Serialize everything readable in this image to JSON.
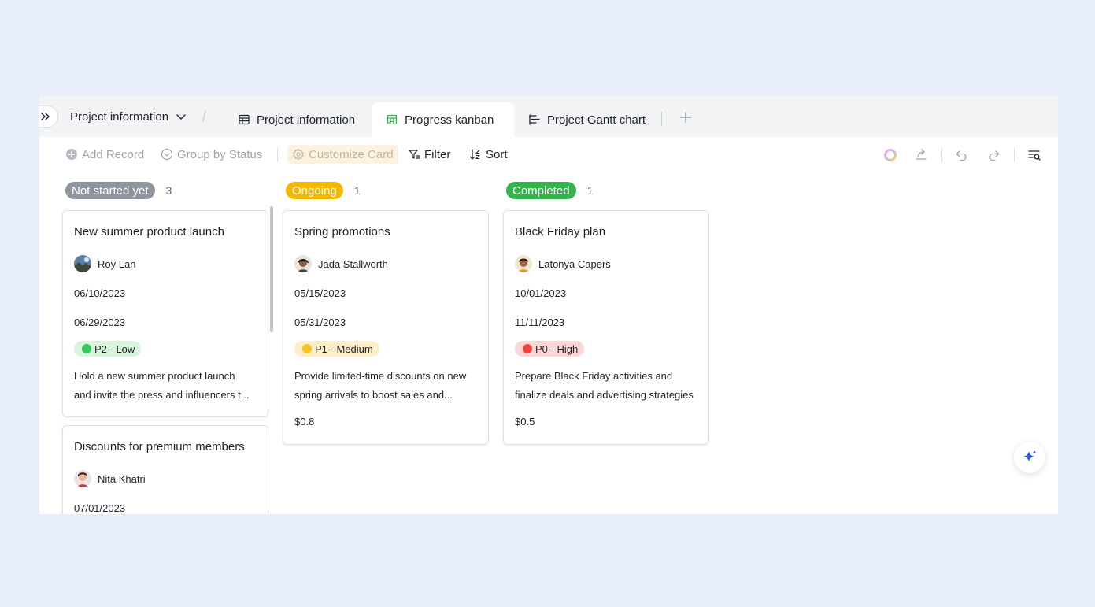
{
  "tabs": {
    "crumb_label": "Project information",
    "items": [
      {
        "label": "Project information",
        "icon": "table-icon",
        "active": false
      },
      {
        "label": "Progress kanban",
        "icon": "kanban-icon",
        "active": true
      },
      {
        "label": "Project Gantt chart",
        "icon": "gantt-icon",
        "active": false
      }
    ],
    "separator": "/"
  },
  "toolbar": {
    "add_record": "Add Record",
    "group_by": "Group by Status",
    "customize_card": "Customize Card",
    "filter": "Filter",
    "sort": "Sort"
  },
  "colors": {
    "accent_green": "#34b34a",
    "not_started": "#8f959e",
    "ongoing": "#f5b800",
    "completed": "#34b34a"
  },
  "columns": [
    {
      "status": "Not started yet",
      "count": "3",
      "color": "#8f959e",
      "cards": [
        {
          "title": "New summer product launch",
          "person": "Roy Lan",
          "start": "06/10/2023",
          "end": "06/29/2023",
          "priority": "P2 - Low",
          "priority_bg": "#d8f5dc",
          "priority_dot": "#34c759",
          "desc_line1": "Hold a new summer product launch",
          "desc_line2": "and invite the press and influencers t...",
          "budget": ""
        },
        {
          "title": "Discounts for premium members",
          "person": "Nita Khatri",
          "start": "07/01/2023"
        }
      ]
    },
    {
      "status": "Ongoing",
      "count": "1",
      "color": "#f5b800",
      "cards": [
        {
          "title": "Spring promotions",
          "person": "Jada Stallworth",
          "start": "05/15/2023",
          "end": "05/31/2023",
          "priority": "P1 - Medium",
          "priority_bg": "#fcefc7",
          "priority_dot": "#f7c325",
          "desc_line1": "Provide limited-time discounts on new",
          "desc_line2": "spring arrivals to boost sales and...",
          "budget": "$0.8"
        }
      ]
    },
    {
      "status": "Completed",
      "count": "1",
      "color": "#34b34a",
      "cards": [
        {
          "title": "Black Friday plan",
          "person": "Latonya Capers",
          "start": "10/01/2023",
          "end": "11/11/2023",
          "priority": "P0 - High",
          "priority_bg": "#fbd6d4",
          "priority_dot": "#f0443a",
          "desc_line1": "Prepare Black Friday activities and",
          "desc_line2": "finalize deals and advertising strategies",
          "budget": "$0.5"
        }
      ]
    }
  ]
}
